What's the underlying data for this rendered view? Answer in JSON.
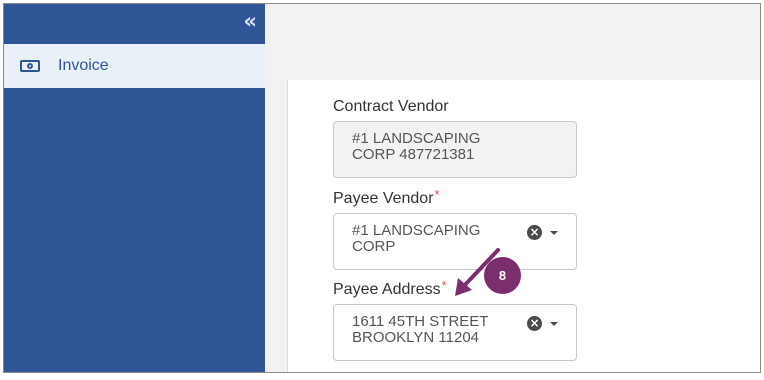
{
  "sidebar": {
    "collapse_glyph": "«",
    "items": [
      {
        "label": "Invoice",
        "icon": "money-icon"
      }
    ]
  },
  "form": {
    "contract_vendor": {
      "label": "Contract Vendor",
      "line1": "#1 LANDSCAPING",
      "line2": "CORP 487721381"
    },
    "payee_vendor": {
      "label": "Payee Vendor",
      "required_mark": "*",
      "line1": "#1 LANDSCAPING",
      "line2": "CORP"
    },
    "payee_address": {
      "label": "Payee Address",
      "required_mark": "*",
      "line1": "1611 45TH STREET",
      "line2": "BROOKLYN 11204"
    }
  },
  "callout": {
    "number": "8",
    "color": "#7b2e6e"
  },
  "colors": {
    "sidebar": "#2f5597",
    "accent_text": "#2f5597",
    "required": "#d9534f"
  }
}
